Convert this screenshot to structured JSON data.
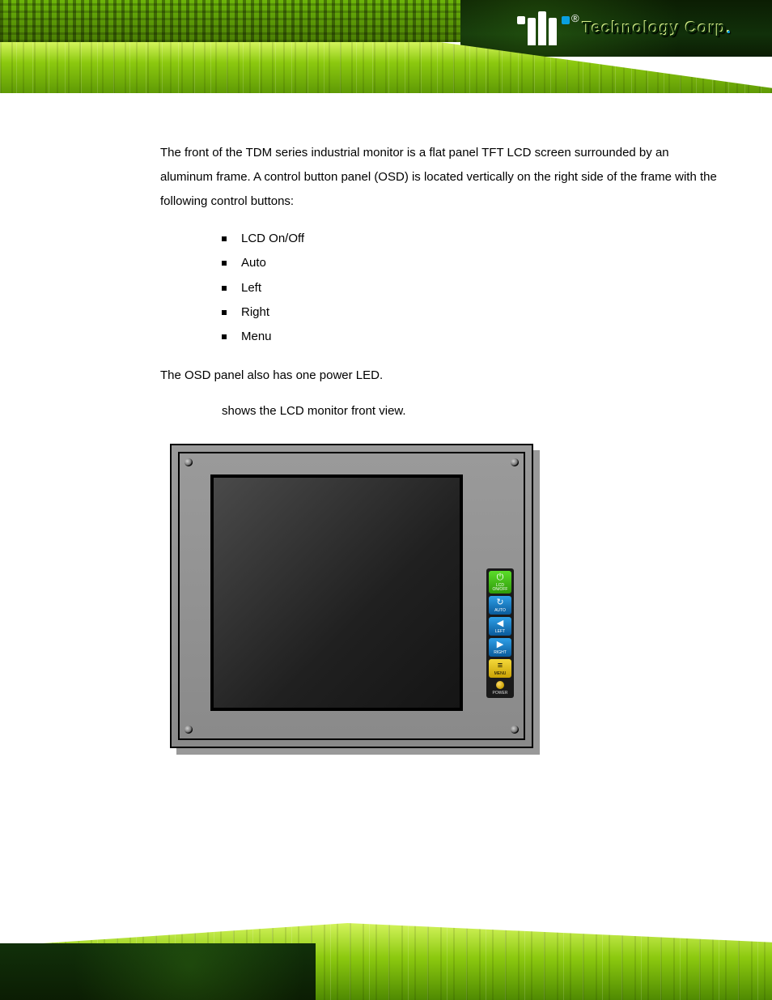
{
  "brand": {
    "registered": "®",
    "name": "Technology Corp",
    "suffix": "."
  },
  "body": {
    "intro": "The front of the TDM series industrial monitor is a flat panel TFT LCD screen surrounded by an aluminum frame. A control button panel (OSD) is located vertically on the right side of the frame with the following control buttons:",
    "buttons": {
      "b0": "LCD On/Off",
      "b1": "Auto",
      "b2": "Left",
      "b3": "Right",
      "b4": "Menu"
    },
    "ledSentence": "The OSD panel also has one power LED.",
    "figSentence": "shows the LCD monitor front view."
  },
  "osd": {
    "lcd": {
      "label": "LCD ON/OFF",
      "color": "green",
      "icon": "⏻"
    },
    "auto": {
      "label": "AUTO",
      "color": "blue",
      "icon": "↻"
    },
    "left": {
      "label": "LEFT",
      "color": "blue",
      "icon": "◀"
    },
    "right": {
      "label": "RIGHT",
      "color": "blue",
      "icon": "▶"
    },
    "menu": {
      "label": "MENU",
      "color": "yellow",
      "icon": "≡"
    },
    "led": {
      "label": "POWER"
    }
  }
}
